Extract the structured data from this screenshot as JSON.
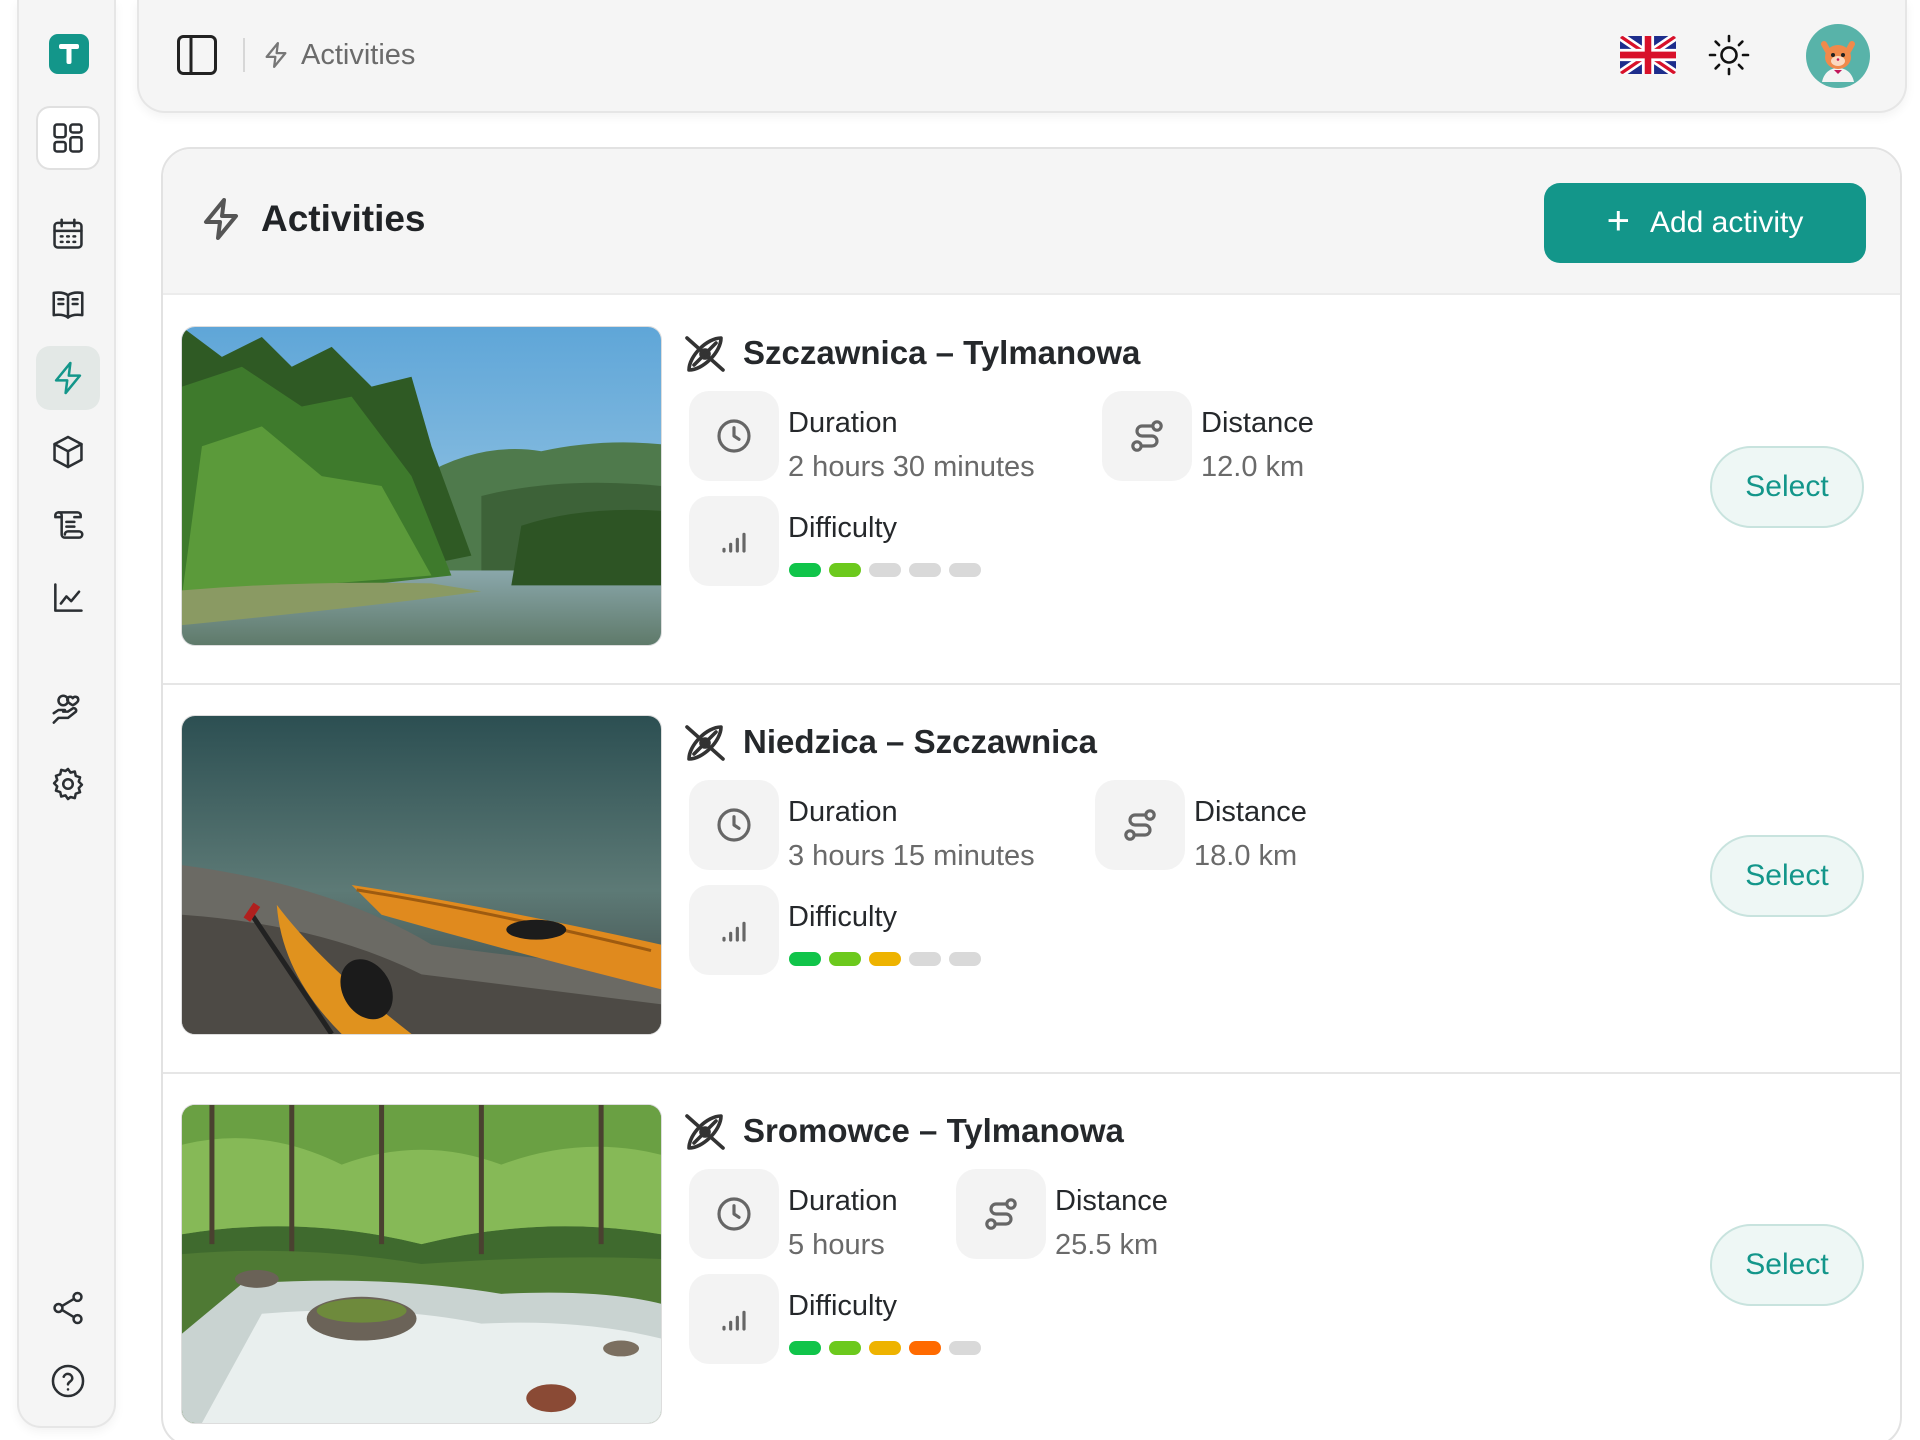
{
  "app": {
    "logo_letter": "T"
  },
  "header": {
    "breadcrumb": "Activities"
  },
  "page": {
    "title": "Activities",
    "add_button_label": "Add activity"
  },
  "labels": {
    "duration": "Duration",
    "distance": "Distance",
    "difficulty": "Difficulty",
    "select": "Select"
  },
  "colors": {
    "accent": "#13968a",
    "difficulty": [
      "#10c44a",
      "#6cc91d",
      "#eeb300",
      "#ff6a00"
    ],
    "difficulty_empty": "#d9d9d9"
  },
  "activities": [
    {
      "title": "Szczawnica – Tylmanowa",
      "duration": "2 hours 30 minutes",
      "distance": "12.0 km",
      "difficulty": 2,
      "image": "forest-river"
    },
    {
      "title": "Niedzica – Szczawnica",
      "duration": "3 hours 15 minutes",
      "distance": "18.0 km",
      "difficulty": 3,
      "image": "kayaks-shore"
    },
    {
      "title": "Sromowce – Tylmanowa",
      "duration": "5 hours",
      "distance": "25.5 km",
      "difficulty": 4,
      "image": "rapids-stream"
    }
  ]
}
